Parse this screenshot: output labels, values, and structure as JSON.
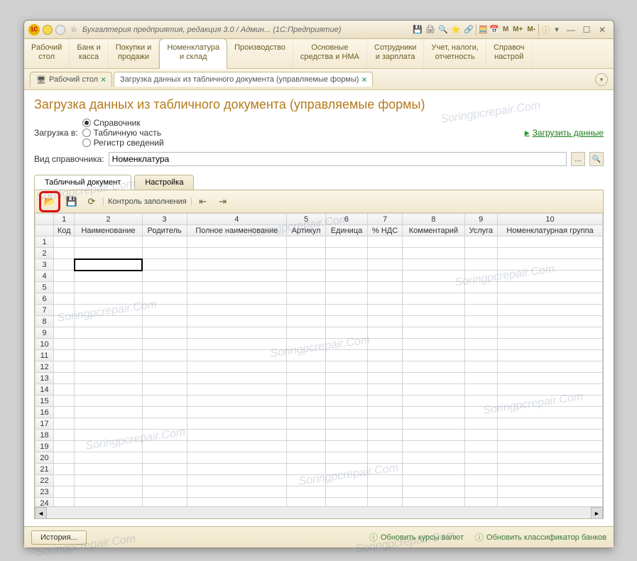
{
  "window": {
    "title": "Бухгалтерия предприятия, редакция 3.0 / Админ...  (1С:Предприятие)"
  },
  "titlebar_m": {
    "m": "M",
    "mplus": "M+",
    "mminus": "M-"
  },
  "mainmenu": {
    "items": [
      {
        "l1": "Рабочий",
        "l2": "стол"
      },
      {
        "l1": "Банк и",
        "l2": "касса"
      },
      {
        "l1": "Покупки и",
        "l2": "продажи"
      },
      {
        "l1": "Номенклатура",
        "l2": "и склад"
      },
      {
        "l1": "Производство",
        "l2": ""
      },
      {
        "l1": "Основные",
        "l2": "средства и НМА"
      },
      {
        "l1": "Сотрудники",
        "l2": "и зарплата"
      },
      {
        "l1": "Учет, налоги,",
        "l2": "отчетность"
      },
      {
        "l1": "Справоч",
        "l2": "настрой"
      }
    ],
    "active": 3
  },
  "tabs": {
    "items": [
      {
        "label": "Рабочий стол"
      },
      {
        "label": "Загрузка данных из табличного документа (управляемые формы)"
      }
    ],
    "active": 1
  },
  "page": {
    "title": "Загрузка данных из табличного документа (управляемые формы)",
    "load_into_label": "Загрузка в:",
    "radios": [
      {
        "label": "Справочник",
        "selected": true
      },
      {
        "label": "Табличную часть",
        "selected": false
      },
      {
        "label": "Регистр сведений",
        "selected": false
      }
    ],
    "load_link": "Загрузить данные",
    "dir_type_label": "Вид справочника:",
    "dir_type_value": "Номенклатура",
    "subtabs": {
      "items": [
        "Табличный документ",
        "Настройка"
      ],
      "active": 0
    },
    "toolbar": {
      "control_label": "Контроль заполнения"
    },
    "grid": {
      "col_numbers": [
        "1",
        "2",
        "3",
        "4",
        "5",
        "6",
        "7",
        "8",
        "9",
        "10"
      ],
      "headers": [
        "Код",
        "Наименование",
        "Родитель",
        "Полное наименование",
        "Артикул",
        "Единица",
        "% НДС",
        "Комментарий",
        "Услуга",
        "Номенклатурная группа"
      ],
      "rows": 26,
      "selected": {
        "row": 3,
        "col": 2
      }
    }
  },
  "statusbar": {
    "history": "История...",
    "link1": "Обновить курсы валют",
    "link2": "Обновить классификатор банков"
  },
  "watermark": "Soringpcrepair.Com"
}
